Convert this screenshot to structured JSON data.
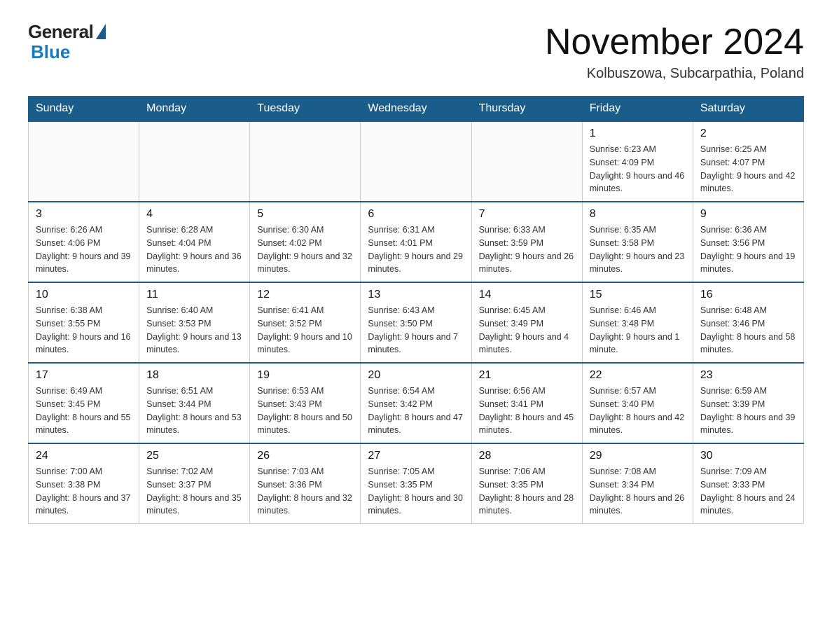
{
  "logo": {
    "general": "General",
    "blue": "Blue"
  },
  "title": "November 2024",
  "subtitle": "Kolbuszowa, Subcarpathia, Poland",
  "days_of_week": [
    "Sunday",
    "Monday",
    "Tuesday",
    "Wednesday",
    "Thursday",
    "Friday",
    "Saturday"
  ],
  "weeks": [
    [
      {
        "day": "",
        "info": ""
      },
      {
        "day": "",
        "info": ""
      },
      {
        "day": "",
        "info": ""
      },
      {
        "day": "",
        "info": ""
      },
      {
        "day": "",
        "info": ""
      },
      {
        "day": "1",
        "info": "Sunrise: 6:23 AM\nSunset: 4:09 PM\nDaylight: 9 hours and 46 minutes."
      },
      {
        "day": "2",
        "info": "Sunrise: 6:25 AM\nSunset: 4:07 PM\nDaylight: 9 hours and 42 minutes."
      }
    ],
    [
      {
        "day": "3",
        "info": "Sunrise: 6:26 AM\nSunset: 4:06 PM\nDaylight: 9 hours and 39 minutes."
      },
      {
        "day": "4",
        "info": "Sunrise: 6:28 AM\nSunset: 4:04 PM\nDaylight: 9 hours and 36 minutes."
      },
      {
        "day": "5",
        "info": "Sunrise: 6:30 AM\nSunset: 4:02 PM\nDaylight: 9 hours and 32 minutes."
      },
      {
        "day": "6",
        "info": "Sunrise: 6:31 AM\nSunset: 4:01 PM\nDaylight: 9 hours and 29 minutes."
      },
      {
        "day": "7",
        "info": "Sunrise: 6:33 AM\nSunset: 3:59 PM\nDaylight: 9 hours and 26 minutes."
      },
      {
        "day": "8",
        "info": "Sunrise: 6:35 AM\nSunset: 3:58 PM\nDaylight: 9 hours and 23 minutes."
      },
      {
        "day": "9",
        "info": "Sunrise: 6:36 AM\nSunset: 3:56 PM\nDaylight: 9 hours and 19 minutes."
      }
    ],
    [
      {
        "day": "10",
        "info": "Sunrise: 6:38 AM\nSunset: 3:55 PM\nDaylight: 9 hours and 16 minutes."
      },
      {
        "day": "11",
        "info": "Sunrise: 6:40 AM\nSunset: 3:53 PM\nDaylight: 9 hours and 13 minutes."
      },
      {
        "day": "12",
        "info": "Sunrise: 6:41 AM\nSunset: 3:52 PM\nDaylight: 9 hours and 10 minutes."
      },
      {
        "day": "13",
        "info": "Sunrise: 6:43 AM\nSunset: 3:50 PM\nDaylight: 9 hours and 7 minutes."
      },
      {
        "day": "14",
        "info": "Sunrise: 6:45 AM\nSunset: 3:49 PM\nDaylight: 9 hours and 4 minutes."
      },
      {
        "day": "15",
        "info": "Sunrise: 6:46 AM\nSunset: 3:48 PM\nDaylight: 9 hours and 1 minute."
      },
      {
        "day": "16",
        "info": "Sunrise: 6:48 AM\nSunset: 3:46 PM\nDaylight: 8 hours and 58 minutes."
      }
    ],
    [
      {
        "day": "17",
        "info": "Sunrise: 6:49 AM\nSunset: 3:45 PM\nDaylight: 8 hours and 55 minutes."
      },
      {
        "day": "18",
        "info": "Sunrise: 6:51 AM\nSunset: 3:44 PM\nDaylight: 8 hours and 53 minutes."
      },
      {
        "day": "19",
        "info": "Sunrise: 6:53 AM\nSunset: 3:43 PM\nDaylight: 8 hours and 50 minutes."
      },
      {
        "day": "20",
        "info": "Sunrise: 6:54 AM\nSunset: 3:42 PM\nDaylight: 8 hours and 47 minutes."
      },
      {
        "day": "21",
        "info": "Sunrise: 6:56 AM\nSunset: 3:41 PM\nDaylight: 8 hours and 45 minutes."
      },
      {
        "day": "22",
        "info": "Sunrise: 6:57 AM\nSunset: 3:40 PM\nDaylight: 8 hours and 42 minutes."
      },
      {
        "day": "23",
        "info": "Sunrise: 6:59 AM\nSunset: 3:39 PM\nDaylight: 8 hours and 39 minutes."
      }
    ],
    [
      {
        "day": "24",
        "info": "Sunrise: 7:00 AM\nSunset: 3:38 PM\nDaylight: 8 hours and 37 minutes."
      },
      {
        "day": "25",
        "info": "Sunrise: 7:02 AM\nSunset: 3:37 PM\nDaylight: 8 hours and 35 minutes."
      },
      {
        "day": "26",
        "info": "Sunrise: 7:03 AM\nSunset: 3:36 PM\nDaylight: 8 hours and 32 minutes."
      },
      {
        "day": "27",
        "info": "Sunrise: 7:05 AM\nSunset: 3:35 PM\nDaylight: 8 hours and 30 minutes."
      },
      {
        "day": "28",
        "info": "Sunrise: 7:06 AM\nSunset: 3:35 PM\nDaylight: 8 hours and 28 minutes."
      },
      {
        "day": "29",
        "info": "Sunrise: 7:08 AM\nSunset: 3:34 PM\nDaylight: 8 hours and 26 minutes."
      },
      {
        "day": "30",
        "info": "Sunrise: 7:09 AM\nSunset: 3:33 PM\nDaylight: 8 hours and 24 minutes."
      }
    ]
  ]
}
